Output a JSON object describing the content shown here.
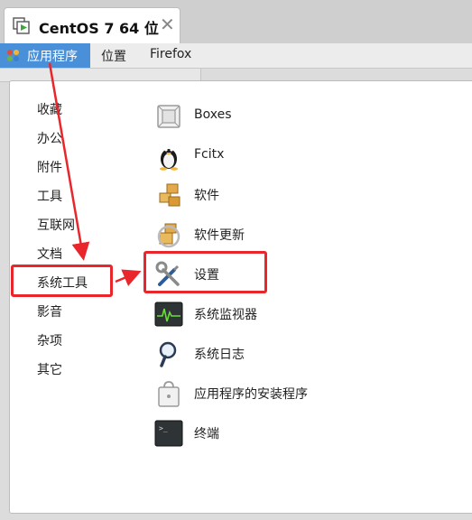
{
  "window": {
    "tab_title": "CentOS 7 64 位",
    "close_glyph": "✕"
  },
  "panel": {
    "apps_label": "应用程序",
    "places_label": "位置",
    "firefox_label": "Firefox"
  },
  "menu": {
    "categories": [
      "收藏",
      "办公",
      "附件",
      "工具",
      "互联网",
      "文档",
      "系统工具",
      "影音",
      "杂项",
      "其它"
    ],
    "apps": [
      {
        "label": "Boxes",
        "icon": "boxes-icon"
      },
      {
        "label": "Fcitx",
        "icon": "penguin-icon"
      },
      {
        "label": "软件",
        "icon": "software-icon"
      },
      {
        "label": "软件更新",
        "icon": "software-update-icon"
      },
      {
        "label": "设置",
        "icon": "settings-tools-icon"
      },
      {
        "label": "系统监视器",
        "icon": "system-monitor-icon"
      },
      {
        "label": "系统日志",
        "icon": "system-log-icon"
      },
      {
        "label": "应用程序的安装程序",
        "icon": "app-installer-icon"
      },
      {
        "label": "终端",
        "icon": "terminal-icon"
      }
    ]
  },
  "colors": {
    "accent": "#4a90d9",
    "annotation": "#e8262b"
  }
}
